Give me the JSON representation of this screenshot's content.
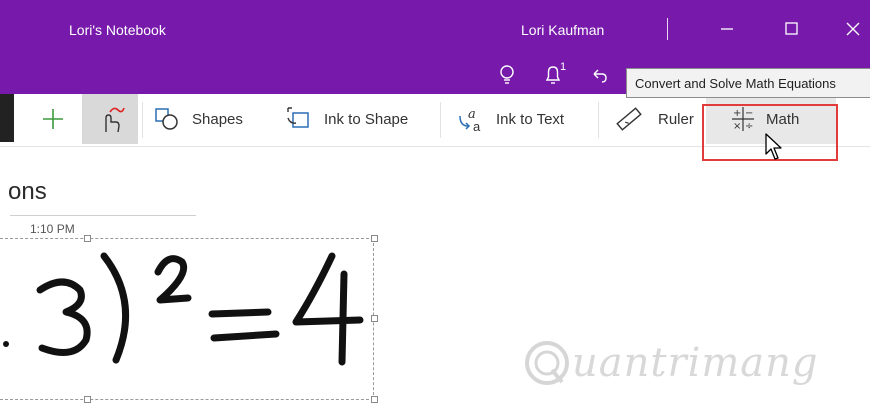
{
  "window": {
    "notebook_title": "Lori's Notebook",
    "user_name": "Lori Kaufman",
    "notification_count": "1"
  },
  "icons": {
    "idea": "lightbulb-icon",
    "notifications": "bell-icon",
    "undo": "undo-icon",
    "minimize": "minimize-icon",
    "maximize": "maximize-icon",
    "close": "close-icon"
  },
  "tooltip": {
    "text": "Convert and Solve Math Equations"
  },
  "ribbon": {
    "items": [
      {
        "id": "add",
        "label": "",
        "icon": "plus-icon"
      },
      {
        "id": "touch-pen",
        "label": "",
        "icon": "touch-draw-icon"
      },
      {
        "id": "shapes",
        "label": "Shapes",
        "icon": "shapes-icon"
      },
      {
        "id": "ink-to-shape",
        "label": "Ink to Shape",
        "icon": "ink-to-shape-icon"
      },
      {
        "id": "ink-to-text",
        "label": "Ink to Text",
        "icon": "ink-to-text-icon"
      },
      {
        "id": "ruler",
        "label": "Ruler",
        "icon": "ruler-icon"
      },
      {
        "id": "math",
        "label": "Math",
        "icon": "math-icon"
      }
    ]
  },
  "page": {
    "title_fragment": "ons",
    "time": "1:10 PM"
  },
  "colors": {
    "accent": "#7719aa",
    "highlight_box": "#e23b3b",
    "active_tool": "#d9d9d9"
  },
  "watermark": {
    "text": "uantrimang"
  }
}
